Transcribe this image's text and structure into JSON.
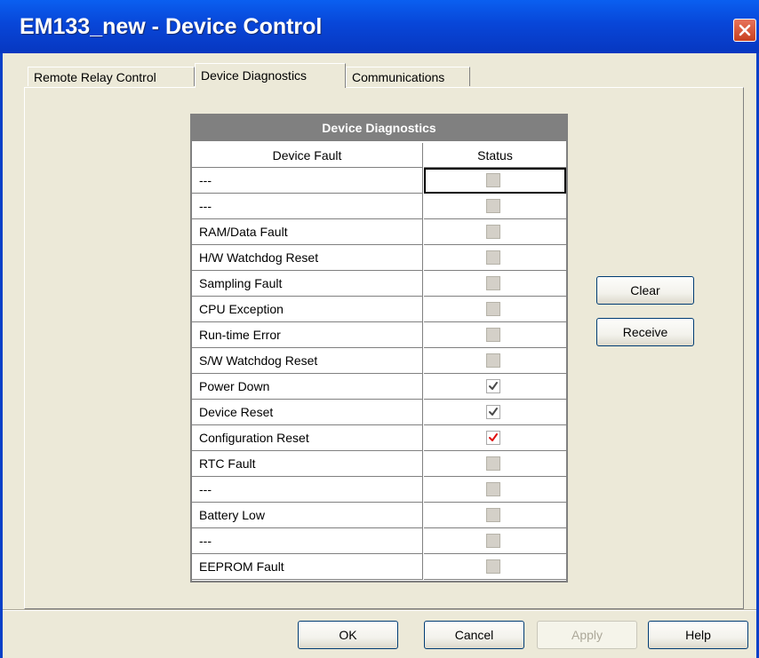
{
  "window": {
    "title": "EM133_new - Device Control"
  },
  "tabs": [
    {
      "label": "Remote Relay Control",
      "active": false
    },
    {
      "label": "Device Diagnostics",
      "active": true
    },
    {
      "label": "Communications",
      "active": false
    }
  ],
  "grid": {
    "title": "Device Diagnostics",
    "columns": {
      "fault": "Device Fault",
      "status": "Status"
    },
    "rows": [
      {
        "fault": "---",
        "checked": false,
        "focused": true
      },
      {
        "fault": "---",
        "checked": false
      },
      {
        "fault": "RAM/Data Fault",
        "checked": false
      },
      {
        "fault": "H/W Watchdog Reset",
        "checked": false
      },
      {
        "fault": "Sampling Fault",
        "checked": false
      },
      {
        "fault": "CPU Exception",
        "checked": false
      },
      {
        "fault": "Run-time Error",
        "checked": false
      },
      {
        "fault": "S/W Watchdog Reset",
        "checked": false
      },
      {
        "fault": "Power Down",
        "checked": true,
        "check_color": "#4a4a4a"
      },
      {
        "fault": "Device Reset",
        "checked": true,
        "check_color": "#4a4a4a"
      },
      {
        "fault": "Configuration Reset",
        "checked": true,
        "check_color": "#e01010"
      },
      {
        "fault": "RTC Fault",
        "checked": false
      },
      {
        "fault": "---",
        "checked": false
      },
      {
        "fault": "Battery Low",
        "checked": false
      },
      {
        "fault": "---",
        "checked": false
      },
      {
        "fault": "EEPROM Fault",
        "checked": false
      }
    ]
  },
  "side_buttons": {
    "clear": "Clear",
    "receive": "Receive"
  },
  "footer_buttons": {
    "ok": "OK",
    "cancel": "Cancel",
    "apply": "Apply",
    "help": "Help"
  },
  "colors": {
    "titlebar": "#0846d8",
    "dialog_bg": "#ece9d8",
    "grid_title_bg": "#808080"
  }
}
